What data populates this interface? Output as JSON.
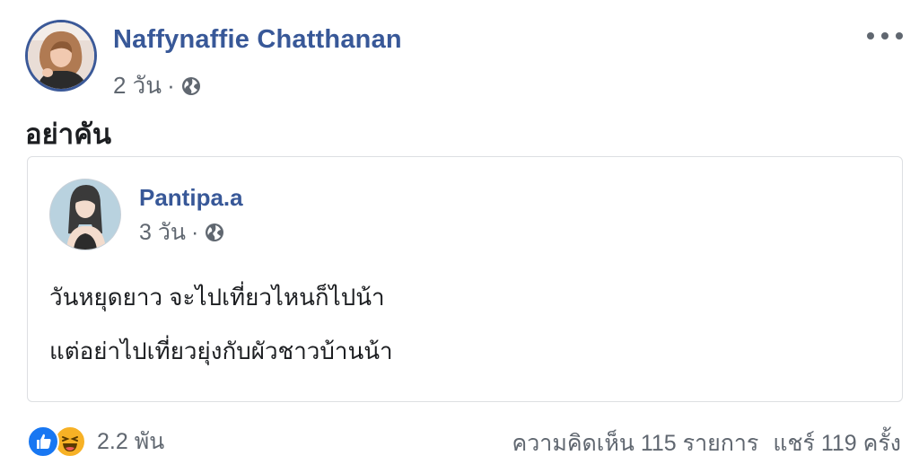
{
  "post": {
    "author": {
      "name": "Naffynaffie Chatthanan"
    },
    "timestamp": "2 วัน",
    "separator": "·",
    "privacy_icon": "globe-icon",
    "more_icon": "more-options-icon",
    "text": "อย่าคัน"
  },
  "shared": {
    "author": {
      "name": "Pantipa.a"
    },
    "timestamp": "3 วัน",
    "separator": "·",
    "privacy_icon": "globe-icon",
    "lines": [
      "วันหยุดยาว จะไปเที่ยวไหนก็ไปน้า",
      "แต่อย่าไปเที่ยวยุ่งกับผัวชาวบ้านน้า"
    ]
  },
  "footer": {
    "reactions": [
      "like-icon",
      "haha-icon"
    ],
    "reaction_count": "2.2 พัน",
    "comments": "ความคิดเห็น 115 รายการ",
    "shares": "แชร์ 119 ครั้ง"
  },
  "colors": {
    "name_blue": "#385898",
    "secondary_text": "#606770",
    "like_blue": "#1877f2",
    "haha_yellow": "#f7b125",
    "border": "#dddfe2"
  }
}
